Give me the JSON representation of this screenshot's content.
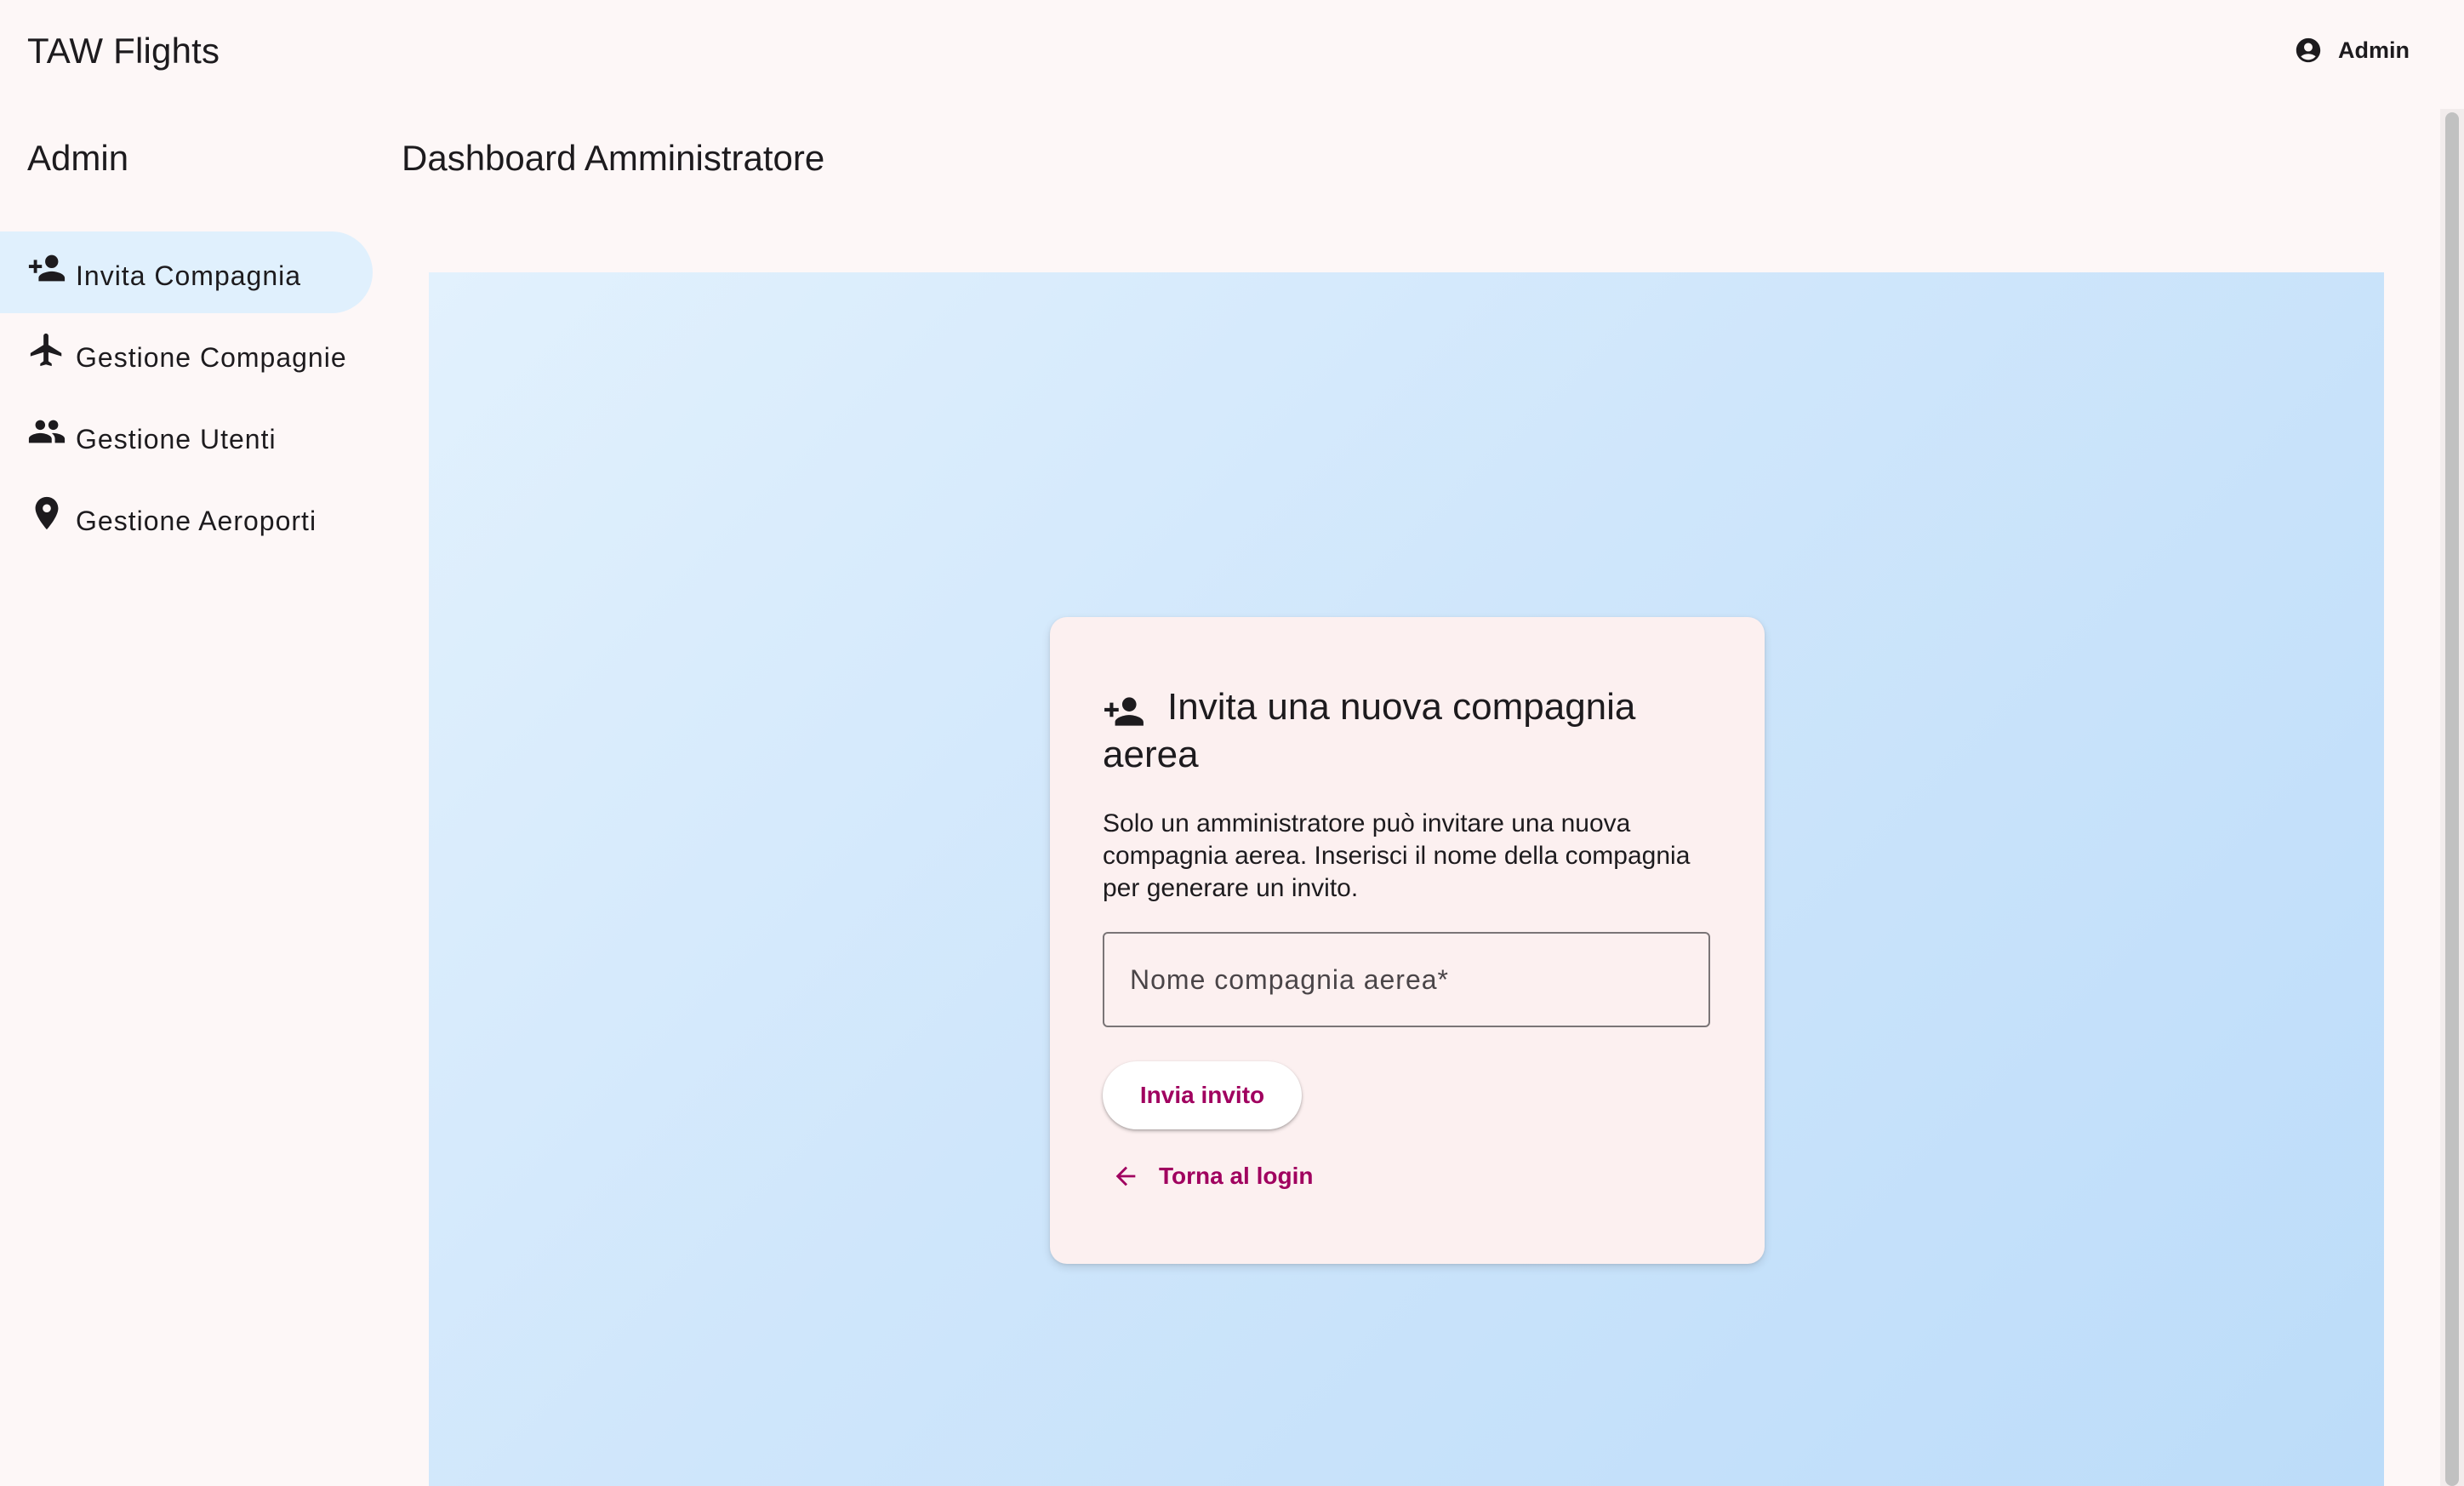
{
  "header": {
    "app_title": "TAW Flights",
    "account_label": "Admin",
    "account_icon": "account-circle-icon"
  },
  "sidebar": {
    "title": "Admin",
    "items": [
      {
        "label": "Invita Compagnia",
        "icon": "person-add-icon",
        "active": true
      },
      {
        "label": "Gestione Compagnie",
        "icon": "airplane-icon",
        "active": false
      },
      {
        "label": "Gestione Utenti",
        "icon": "people-icon",
        "active": false
      },
      {
        "label": "Gestione Aeroporti",
        "icon": "location-pin-icon",
        "active": false
      }
    ]
  },
  "main": {
    "page_title": "Dashboard Amministratore"
  },
  "invite_card": {
    "title": "Invita una nuova compagnia aerea",
    "description": "Solo un amministratore può invitare una nuova compagnia aerea. Inserisci il nome della compagnia per generare un invito.",
    "input": {
      "placeholder": "Nome compagnia aerea*",
      "value": ""
    },
    "submit_label": "Invia invito",
    "back_label": "Torna al login"
  },
  "colors": {
    "accent": "#a0005f",
    "active_nav_bg": "#e0f0fd",
    "background": "#fdf7f7",
    "card_bg": "#fcf0f0"
  }
}
